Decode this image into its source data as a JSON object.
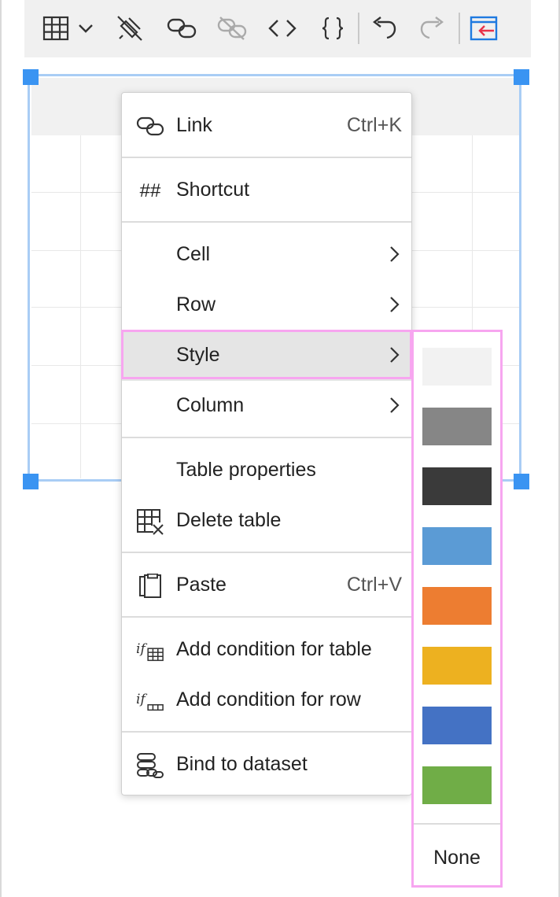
{
  "toolbar": {
    "buttons": [
      {
        "icon": "table-icon"
      },
      {
        "icon": "chevron-down-icon"
      },
      {
        "icon": "clear-format-icon"
      },
      {
        "icon": "link-icon"
      },
      {
        "icon": "unlink-icon"
      },
      {
        "icon": "code-icon"
      },
      {
        "icon": "braces-icon"
      },
      {
        "icon": "undo-icon"
      },
      {
        "icon": "redo-icon"
      },
      {
        "icon": "exit-icon"
      }
    ]
  },
  "context_menu": {
    "items": [
      {
        "label": "Link",
        "shortcut": "Ctrl+K",
        "icon": "link-icon"
      },
      {
        "label": "Shortcut",
        "icon": "hash-icon",
        "icon_text": "##"
      },
      {
        "label": "Cell",
        "submenu": true
      },
      {
        "label": "Row",
        "submenu": true
      },
      {
        "label": "Style",
        "submenu": true,
        "active": true
      },
      {
        "label": "Column",
        "submenu": true
      },
      {
        "label": "Table properties"
      },
      {
        "label": "Delete table",
        "icon": "delete-table-icon"
      },
      {
        "label": "Paste",
        "shortcut": "Ctrl+V",
        "icon": "paste-icon"
      },
      {
        "label": "Add condition for table",
        "icon": "condition-table-icon"
      },
      {
        "label": "Add condition for row",
        "icon": "condition-row-icon"
      },
      {
        "label": "Bind to dataset",
        "icon": "database-icon"
      }
    ]
  },
  "style_submenu": {
    "swatches": [
      "#f2f2f2",
      "#868686",
      "#3a3a3a",
      "#5b9bd5",
      "#ed7d31",
      "#edb120",
      "#4472c4",
      "#70ad47"
    ],
    "none_label": "None"
  },
  "colors": {
    "selection_border": "#a9cdf5",
    "handle": "#3a94f2",
    "highlight": "#f7a6f0",
    "exit_icon_red": "#e8334a",
    "exit_icon_blue": "#1f7ae0"
  }
}
